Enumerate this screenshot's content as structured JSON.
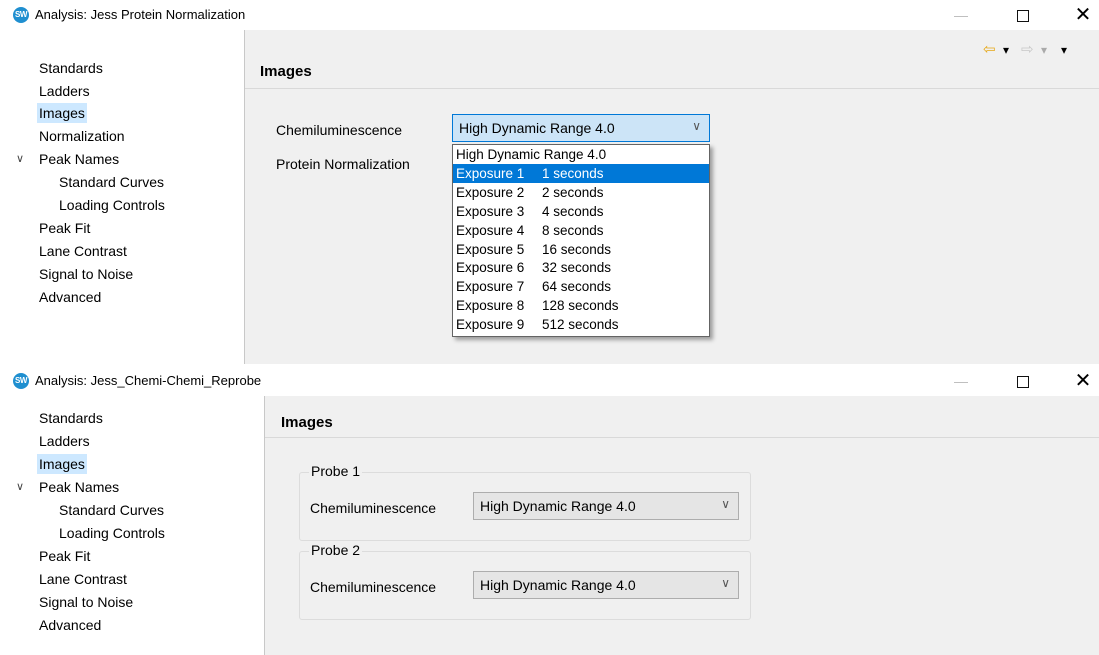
{
  "windows": {
    "w1": {
      "icon_text": "SW",
      "title": "Analysis: Jess Protein Normalization",
      "nav": {
        "standards": "Standards",
        "ladders": "Ladders",
        "images": "Images",
        "normalization": "Normalization",
        "peak_names": "Peak Names",
        "standard_curves": "Standard Curves",
        "loading_controls": "Loading Controls",
        "peak_fit": "Peak Fit",
        "lane_contrast": "Lane Contrast",
        "signal_to_noise": "Signal to Noise",
        "advanced": "Advanced"
      },
      "header_title": "Images",
      "chemi_label": "Chemiluminescence",
      "chemi_value": "High Dynamic Range 4.0",
      "protein_label": "Protein Normalization",
      "dropdown_options": [
        {
          "name": "High Dynamic Range 4.0",
          "time": ""
        },
        {
          "name": "Exposure 1",
          "time": "1 seconds"
        },
        {
          "name": "Exposure 2",
          "time": "2 seconds"
        },
        {
          "name": "Exposure 3",
          "time": "4 seconds"
        },
        {
          "name": "Exposure 4",
          "time": "8 seconds"
        },
        {
          "name": "Exposure 5",
          "time": "16 seconds"
        },
        {
          "name": "Exposure 6",
          "time": "32 seconds"
        },
        {
          "name": "Exposure 7",
          "time": "64 seconds"
        },
        {
          "name": "Exposure 8",
          "time": "128 seconds"
        },
        {
          "name": "Exposure 9",
          "time": "512 seconds"
        }
      ],
      "highlighted_option": "Exposure 1"
    },
    "w2": {
      "icon_text": "SW",
      "title": "Analysis: Jess_Chemi-Chemi_Reprobe",
      "nav": {
        "standards": "Standards",
        "ladders": "Ladders",
        "images": "Images",
        "peak_names": "Peak Names",
        "standard_curves": "Standard Curves",
        "loading_controls": "Loading Controls",
        "peak_fit": "Peak Fit",
        "lane_contrast": "Lane Contrast",
        "signal_to_noise": "Signal to Noise",
        "advanced": "Advanced"
      },
      "header_title": "Images",
      "probes": [
        {
          "label": "Probe 1",
          "field_label": "Chemiluminescence",
          "value": "High Dynamic Range 4.0"
        },
        {
          "label": "Probe 2",
          "field_label": "Chemiluminescence",
          "value": "High Dynamic Range 4.0"
        }
      ]
    }
  },
  "icons": {
    "minimize": "—",
    "close": "✕",
    "expand_chevron": "∨",
    "combo_chevron": "∨",
    "back_arrow": "⇦",
    "forward_arrow": "⇨",
    "menu_arrow": "▾"
  },
  "colors": {
    "accent": "#0078d7",
    "selected_nav": "#cde8ff",
    "toolbar_back": "#e6a817",
    "toolbar_disabled": "#c8c8c8"
  }
}
